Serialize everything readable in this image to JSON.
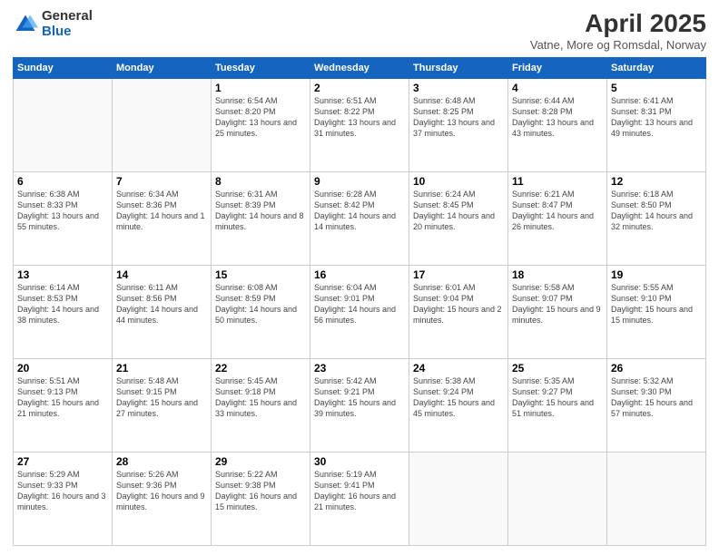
{
  "logo": {
    "general": "General",
    "blue": "Blue"
  },
  "title": "April 2025",
  "subtitle": "Vatne, More og Romsdal, Norway",
  "weekdays": [
    "Sunday",
    "Monday",
    "Tuesday",
    "Wednesday",
    "Thursday",
    "Friday",
    "Saturday"
  ],
  "weeks": [
    [
      {
        "day": "",
        "info": ""
      },
      {
        "day": "",
        "info": ""
      },
      {
        "day": "1",
        "info": "Sunrise: 6:54 AM\nSunset: 8:20 PM\nDaylight: 13 hours and 25 minutes."
      },
      {
        "day": "2",
        "info": "Sunrise: 6:51 AM\nSunset: 8:22 PM\nDaylight: 13 hours and 31 minutes."
      },
      {
        "day": "3",
        "info": "Sunrise: 6:48 AM\nSunset: 8:25 PM\nDaylight: 13 hours and 37 minutes."
      },
      {
        "day": "4",
        "info": "Sunrise: 6:44 AM\nSunset: 8:28 PM\nDaylight: 13 hours and 43 minutes."
      },
      {
        "day": "5",
        "info": "Sunrise: 6:41 AM\nSunset: 8:31 PM\nDaylight: 13 hours and 49 minutes."
      }
    ],
    [
      {
        "day": "6",
        "info": "Sunrise: 6:38 AM\nSunset: 8:33 PM\nDaylight: 13 hours and 55 minutes."
      },
      {
        "day": "7",
        "info": "Sunrise: 6:34 AM\nSunset: 8:36 PM\nDaylight: 14 hours and 1 minute."
      },
      {
        "day": "8",
        "info": "Sunrise: 6:31 AM\nSunset: 8:39 PM\nDaylight: 14 hours and 8 minutes."
      },
      {
        "day": "9",
        "info": "Sunrise: 6:28 AM\nSunset: 8:42 PM\nDaylight: 14 hours and 14 minutes."
      },
      {
        "day": "10",
        "info": "Sunrise: 6:24 AM\nSunset: 8:45 PM\nDaylight: 14 hours and 20 minutes."
      },
      {
        "day": "11",
        "info": "Sunrise: 6:21 AM\nSunset: 8:47 PM\nDaylight: 14 hours and 26 minutes."
      },
      {
        "day": "12",
        "info": "Sunrise: 6:18 AM\nSunset: 8:50 PM\nDaylight: 14 hours and 32 minutes."
      }
    ],
    [
      {
        "day": "13",
        "info": "Sunrise: 6:14 AM\nSunset: 8:53 PM\nDaylight: 14 hours and 38 minutes."
      },
      {
        "day": "14",
        "info": "Sunrise: 6:11 AM\nSunset: 8:56 PM\nDaylight: 14 hours and 44 minutes."
      },
      {
        "day": "15",
        "info": "Sunrise: 6:08 AM\nSunset: 8:59 PM\nDaylight: 14 hours and 50 minutes."
      },
      {
        "day": "16",
        "info": "Sunrise: 6:04 AM\nSunset: 9:01 PM\nDaylight: 14 hours and 56 minutes."
      },
      {
        "day": "17",
        "info": "Sunrise: 6:01 AM\nSunset: 9:04 PM\nDaylight: 15 hours and 2 minutes."
      },
      {
        "day": "18",
        "info": "Sunrise: 5:58 AM\nSunset: 9:07 PM\nDaylight: 15 hours and 9 minutes."
      },
      {
        "day": "19",
        "info": "Sunrise: 5:55 AM\nSunset: 9:10 PM\nDaylight: 15 hours and 15 minutes."
      }
    ],
    [
      {
        "day": "20",
        "info": "Sunrise: 5:51 AM\nSunset: 9:13 PM\nDaylight: 15 hours and 21 minutes."
      },
      {
        "day": "21",
        "info": "Sunrise: 5:48 AM\nSunset: 9:15 PM\nDaylight: 15 hours and 27 minutes."
      },
      {
        "day": "22",
        "info": "Sunrise: 5:45 AM\nSunset: 9:18 PM\nDaylight: 15 hours and 33 minutes."
      },
      {
        "day": "23",
        "info": "Sunrise: 5:42 AM\nSunset: 9:21 PM\nDaylight: 15 hours and 39 minutes."
      },
      {
        "day": "24",
        "info": "Sunrise: 5:38 AM\nSunset: 9:24 PM\nDaylight: 15 hours and 45 minutes."
      },
      {
        "day": "25",
        "info": "Sunrise: 5:35 AM\nSunset: 9:27 PM\nDaylight: 15 hours and 51 minutes."
      },
      {
        "day": "26",
        "info": "Sunrise: 5:32 AM\nSunset: 9:30 PM\nDaylight: 15 hours and 57 minutes."
      }
    ],
    [
      {
        "day": "27",
        "info": "Sunrise: 5:29 AM\nSunset: 9:33 PM\nDaylight: 16 hours and 3 minutes."
      },
      {
        "day": "28",
        "info": "Sunrise: 5:26 AM\nSunset: 9:36 PM\nDaylight: 16 hours and 9 minutes."
      },
      {
        "day": "29",
        "info": "Sunrise: 5:22 AM\nSunset: 9:38 PM\nDaylight: 16 hours and 15 minutes."
      },
      {
        "day": "30",
        "info": "Sunrise: 5:19 AM\nSunset: 9:41 PM\nDaylight: 16 hours and 21 minutes."
      },
      {
        "day": "",
        "info": ""
      },
      {
        "day": "",
        "info": ""
      },
      {
        "day": "",
        "info": ""
      }
    ]
  ]
}
